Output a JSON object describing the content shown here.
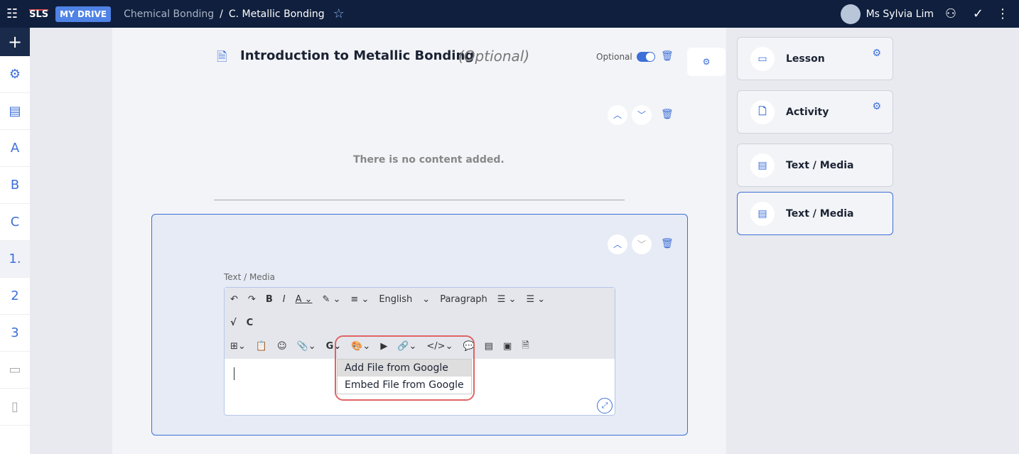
{
  "header": {
    "logo": "SLS",
    "drive": "MY DRIVE",
    "breadcrumb": [
      "Chemical Bonding",
      "/",
      "C. Metallic Bonding"
    ],
    "user": "Ms Sylvia Lim"
  },
  "sidebar": {
    "add": "+",
    "items": [
      "tree",
      "book",
      "A",
      "B",
      "C",
      "1.",
      "2",
      "3",
      "doc",
      "note"
    ]
  },
  "section": {
    "title": "Introduction to Metallic Bonding",
    "optional": "(Optional)",
    "toggle_label": "Optional",
    "toggle_on": true,
    "empty": "There is no content added."
  },
  "editor": {
    "label": "Text / Media",
    "language": "English",
    "format": "Paragraph",
    "dropdown": [
      "Add File from Google",
      "Embed File from Google"
    ]
  },
  "panel": {
    "cards": [
      "Lesson",
      "Activity",
      "Text / Media",
      "Text / Media"
    ]
  }
}
